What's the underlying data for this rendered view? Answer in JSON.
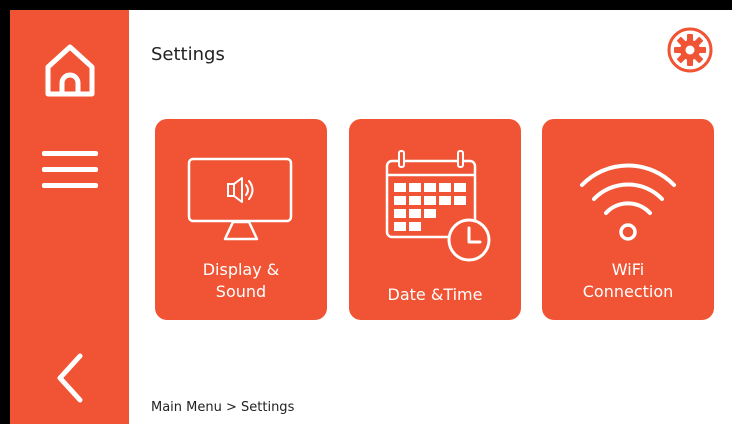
{
  "header": {
    "title": "Settings"
  },
  "sidebar": {
    "items": [
      {
        "name": "home",
        "icon": "home-icon"
      },
      {
        "name": "menu",
        "icon": "hamburger-menu-icon"
      },
      {
        "name": "back",
        "icon": "chevron-left-icon"
      }
    ]
  },
  "settings_icon": "gear-icon",
  "tiles": [
    {
      "line1": "Display &",
      "line2": "Sound",
      "icon": "monitor-speaker-icon"
    },
    {
      "line1": "Date &Time",
      "line2": "",
      "icon": "calendar-clock-icon"
    },
    {
      "line1": "WiFi",
      "line2": "Connection",
      "icon": "wifi-icon"
    }
  ],
  "breadcrumb": "Main Menu > Settings",
  "colors": {
    "accent": "#f05434",
    "background": "#ffffff",
    "bezel": "#000000",
    "text": "#222222"
  }
}
